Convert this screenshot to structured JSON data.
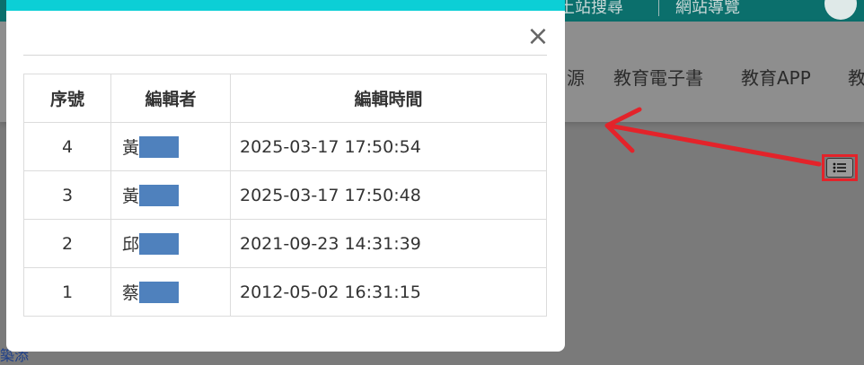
{
  "background": {
    "topbar": {
      "item1": "土站搜尋",
      "item2": "網站導覽"
    },
    "nav": {
      "items": [
        "源",
        "教育電子書",
        "教育APP",
        "教"
      ]
    },
    "bottom_text": "築添"
  },
  "modal": {
    "close_label": "×",
    "columns": [
      "序號",
      "編輯者",
      "編輯時間"
    ],
    "rows": [
      {
        "seq": "4",
        "editor": "黃",
        "time": "2025-03-17 17:50:54"
      },
      {
        "seq": "3",
        "editor": "黃",
        "time": "2025-03-17 17:50:48"
      },
      {
        "seq": "2",
        "editor": "邱",
        "time": "2021-09-23 14:31:39"
      },
      {
        "seq": "1",
        "editor": "蔡",
        "time": "2012-05-02 16:31:15"
      }
    ]
  },
  "colors": {
    "accent": "#0ccfd6",
    "highlight": "#e3232a",
    "redaction": "#4f81bd"
  },
  "icons": {
    "close": "close-icon",
    "list": "list-icon"
  }
}
